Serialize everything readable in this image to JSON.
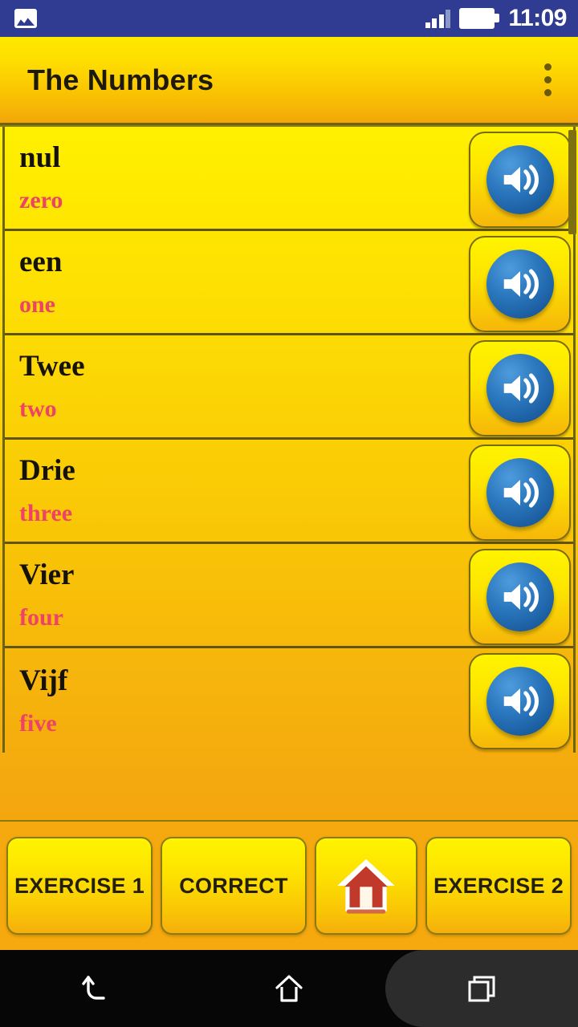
{
  "status_bar": {
    "left_icon": "picture-icon",
    "signal_icon": "signal-bars-icon",
    "signal_bars_filled": 3,
    "signal_bars_total": 4,
    "battery_icon": "battery-full-icon",
    "clock": "11:09",
    "background_color": "#2F3C92"
  },
  "app_bar": {
    "title": "The Numbers",
    "overflow_icon": "overflow-menu-icon",
    "gradient_top": "#FFE900",
    "gradient_bottom": "#F3A608",
    "title_color": "#1D1A0C"
  },
  "list": {
    "scrollbar_icon": "scrollbar-thumb",
    "word_color": "#151208",
    "translation_color": "#EE4266",
    "divider_color": "#5F5510",
    "speaker_icon": "speaker-volume-icon",
    "rows": [
      {
        "word": "nul",
        "translation": "zero"
      },
      {
        "word": "een",
        "translation": "one"
      },
      {
        "word": "Twee",
        "translation": "two"
      },
      {
        "word": "Drie",
        "translation": "three"
      },
      {
        "word": "Vier",
        "translation": "four"
      },
      {
        "word": "Vijf",
        "translation": "five"
      }
    ]
  },
  "button_bar": {
    "background_color": "#F5A90E",
    "buttons": [
      {
        "label": "EXERCISE 1",
        "name": "exercise-1-button"
      },
      {
        "label": "CORRECT",
        "name": "correct-button"
      },
      {
        "label": "",
        "name": "home-button",
        "icon": "house-icon"
      },
      {
        "label": "EXERCISE 2",
        "name": "exercise-2-button"
      }
    ],
    "home_icon_color": "#C0392B"
  },
  "nav_bar": {
    "back_icon": "back-arrow-icon",
    "home_icon": "home-outline-icon",
    "recents_icon": "recents-squares-icon",
    "background_color": "#060606",
    "recents_highlight_color": "#2C2C2C"
  }
}
